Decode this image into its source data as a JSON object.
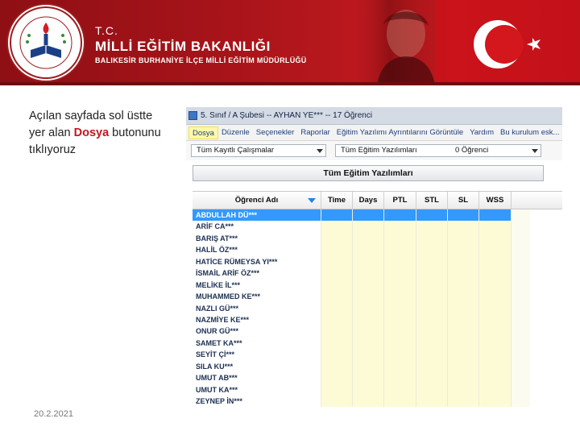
{
  "banner": {
    "tc": "T.C.",
    "ministry_name": "MİLLİ EĞİTİM BAKANLIĞI",
    "directorate": "BALIKESİR   BURHANİYE İLÇE MİLLİ EĞİTİM MÜDÜRLÜĞÜ",
    "logo_ring_text": "T.C. MİLLİ EĞİTİM BAKANLIĞI",
    "colors": {
      "banner_red": "#a8141a",
      "flag_red": "#e30a17"
    }
  },
  "slide": {
    "instruction_before": "Açılan sayfada sol üstte yer alan ",
    "instruction_highlight": "Dosya",
    "instruction_after": " butonunu tıklıyoruz",
    "date": "20.2.2021"
  },
  "app": {
    "window_title": "5. Sınıf / A Şubesi -- AYHAN YE*** -- 17 Öğrenci",
    "menu": [
      {
        "label": "Dosya",
        "active": true
      },
      {
        "label": "Düzenle"
      },
      {
        "label": "Seçenekler"
      },
      {
        "label": "Raporlar"
      },
      {
        "label": "Eğitim Yazılımı Ayrıntılarını Görüntüle"
      },
      {
        "label": "Yardım"
      },
      {
        "label": "Bu kurulum esk..."
      }
    ],
    "filter_left": {
      "value": "Tüm Kayıtlı Çalışmalar"
    },
    "filter_right": {
      "value": "Tüm Eğitim Yazılımları",
      "count": "0 Öğrenci"
    },
    "panel_title": "Tüm Eğitim Yazılımları",
    "columns": [
      "Öğrenci Adı",
      "Time",
      "Days",
      "PTL",
      "STL",
      "SL",
      "WSS"
    ],
    "students": [
      "ABDULLAH DÜ***",
      "ARİF CA***",
      "BARIŞ AT***",
      "HALİL ÖZ***",
      "HATİCE RÜMEYSA YI***",
      "İSMAİL ARİF ÖZ***",
      "MELİKE İL***",
      "MUHAMMED KE***",
      "NAZLI GÜ***",
      "NAZMİYE KE***",
      "ONUR GÜ***",
      "SAMET KA***",
      "SEYİT Çİ***",
      "SILA KU***",
      "UMUT AB***",
      "UMUT KA***",
      "ZEYNEP İN***"
    ],
    "selected_row": 0
  }
}
